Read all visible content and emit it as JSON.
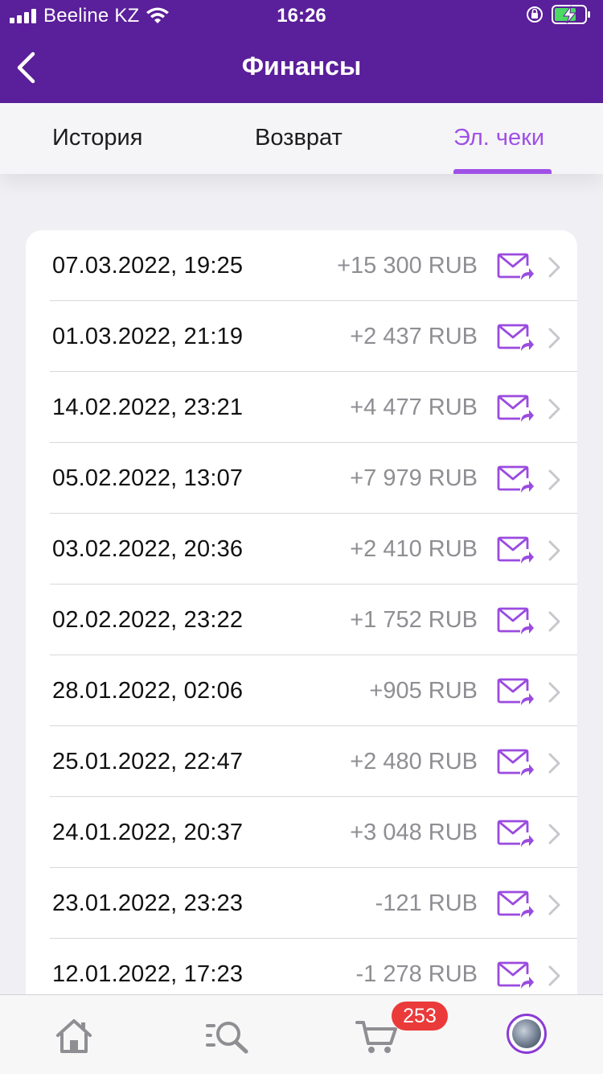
{
  "status_bar": {
    "carrier": "Beeline KZ",
    "time": "16:26",
    "icons": [
      "signal-icon",
      "wifi-icon",
      "orientation-lock-icon",
      "battery-charging-icon"
    ]
  },
  "nav": {
    "title": "Финансы",
    "back_icon": "chevron-left-icon"
  },
  "tabs": [
    {
      "label": "История",
      "active": false
    },
    {
      "label": "Возврат",
      "active": false
    },
    {
      "label": "Эл. чеки",
      "active": true
    }
  ],
  "receipts": [
    {
      "date": "07.03.2022, 19:25",
      "amount": "+15 300 RUB"
    },
    {
      "date": "01.03.2022, 21:19",
      "amount": "+2 437 RUB"
    },
    {
      "date": "14.02.2022, 23:21",
      "amount": "+4 477 RUB"
    },
    {
      "date": "05.02.2022, 13:07",
      "amount": "+7 979 RUB"
    },
    {
      "date": "03.02.2022, 20:36",
      "amount": "+2 410 RUB"
    },
    {
      "date": "02.02.2022, 23:22",
      "amount": "+1 752 RUB"
    },
    {
      "date": "28.01.2022, 02:06",
      "amount": "+905 RUB"
    },
    {
      "date": "25.01.2022, 22:47",
      "amount": "+2 480 RUB"
    },
    {
      "date": "24.01.2022, 20:37",
      "amount": "+3 048 RUB"
    },
    {
      "date": "23.01.2022, 23:23",
      "amount": "-121 RUB"
    },
    {
      "date": "12.01.2022, 17:23",
      "amount": "-1 278 RUB"
    }
  ],
  "bottom_bar": {
    "items": [
      "home-icon",
      "search-icon",
      "cart-icon",
      "profile-avatar"
    ],
    "cart_badge": "253"
  },
  "colors": {
    "header": "#5a1f9a",
    "accent": "#a050e6",
    "badge": "#ea3a3a"
  }
}
